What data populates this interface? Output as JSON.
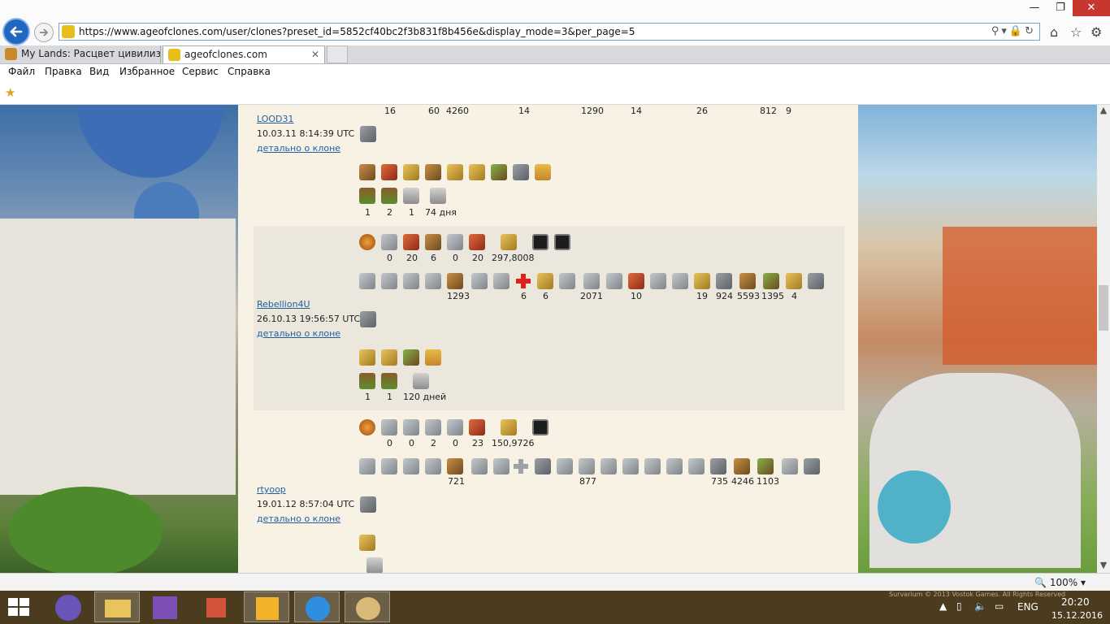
{
  "browser": {
    "url": "https://www.ageofclones.com/user/clones?preset_id=5852cf40bc2f3b831f8b456e&display_mode=3&per_page=5",
    "tabs": [
      {
        "label": "My Lands: Расцвет цивилизац...",
        "active": false
      },
      {
        "label": "ageofclones.com",
        "active": true
      }
    ],
    "menu": [
      "Файл",
      "Правка",
      "Вид",
      "Избранное",
      "Сервис",
      "Справка"
    ],
    "window_controls": {
      "minimize": "—",
      "maximize": "❐",
      "close": "✕"
    },
    "tab_close": "✕"
  },
  "top_numbers": [
    "16",
    "60",
    "4260",
    "14",
    "1290",
    "14",
    "26",
    "812",
    "9"
  ],
  "clones": [
    {
      "name": "LOOD31",
      "date": "10.03.11 8:14:39 UTC",
      "detail": "детально о клоне",
      "bottom_counts": [
        "1",
        "2",
        "1",
        "74 дня"
      ]
    },
    {
      "name": "Rebellion4U",
      "date": "26.10.13 19:56:57 UTC",
      "detail": "детально о клоне",
      "top_counts": [
        "0",
        "20",
        "6",
        "0",
        "20",
        "297,8008"
      ],
      "unit_counts": [
        "1293",
        "6",
        "6",
        "2071",
        "10",
        "19",
        "924",
        "5593",
        "1395",
        "4"
      ],
      "bottom_counts": [
        "1",
        "1",
        "120 дней"
      ]
    },
    {
      "name": "rtyoop",
      "date": "19.01.12 8:57:04 UTC",
      "detail": "детально о клоне",
      "top_counts": [
        "0",
        "0",
        "2",
        "0",
        "23",
        "150,9726"
      ],
      "unit_counts": [
        "721",
        "877",
        "735",
        "4246",
        "1103"
      ]
    }
  ],
  "status": {
    "zoom": "100%"
  },
  "taskbar": {
    "watermark": "Survarium © 2013 Vostok Games. All Rights Reserved",
    "language": "ENG",
    "time": "20:20",
    "date": "15.12.2016"
  }
}
